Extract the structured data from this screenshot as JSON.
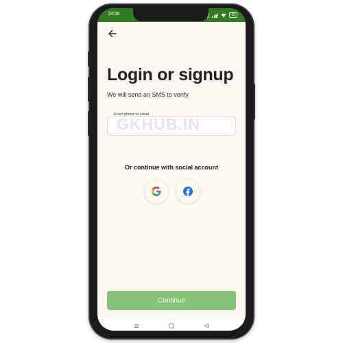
{
  "status_bar": {
    "time": "19:56",
    "battery": "65"
  },
  "header": {
    "back_icon": "arrow-left-icon"
  },
  "main": {
    "title": "Login or signup",
    "subtitle": "We will send an SMS to verify",
    "field_label": "Enter phone or email",
    "field_value": "",
    "watermark": "GKHUB.IN",
    "social_prompt": "Or continue with social account",
    "social_buttons": [
      {
        "name": "google",
        "icon": "google-icon"
      },
      {
        "name": "facebook",
        "icon": "facebook-icon"
      }
    ],
    "continue_label": "Continue"
  },
  "navbar": {
    "items": [
      "menu-icon",
      "home-square-icon",
      "back-triangle-icon"
    ]
  },
  "colors": {
    "status_bar": "#2f7d1f",
    "screen_background": "#fdf8f1",
    "continue_button": "#86c47a",
    "facebook_blue": "#1877f2"
  }
}
